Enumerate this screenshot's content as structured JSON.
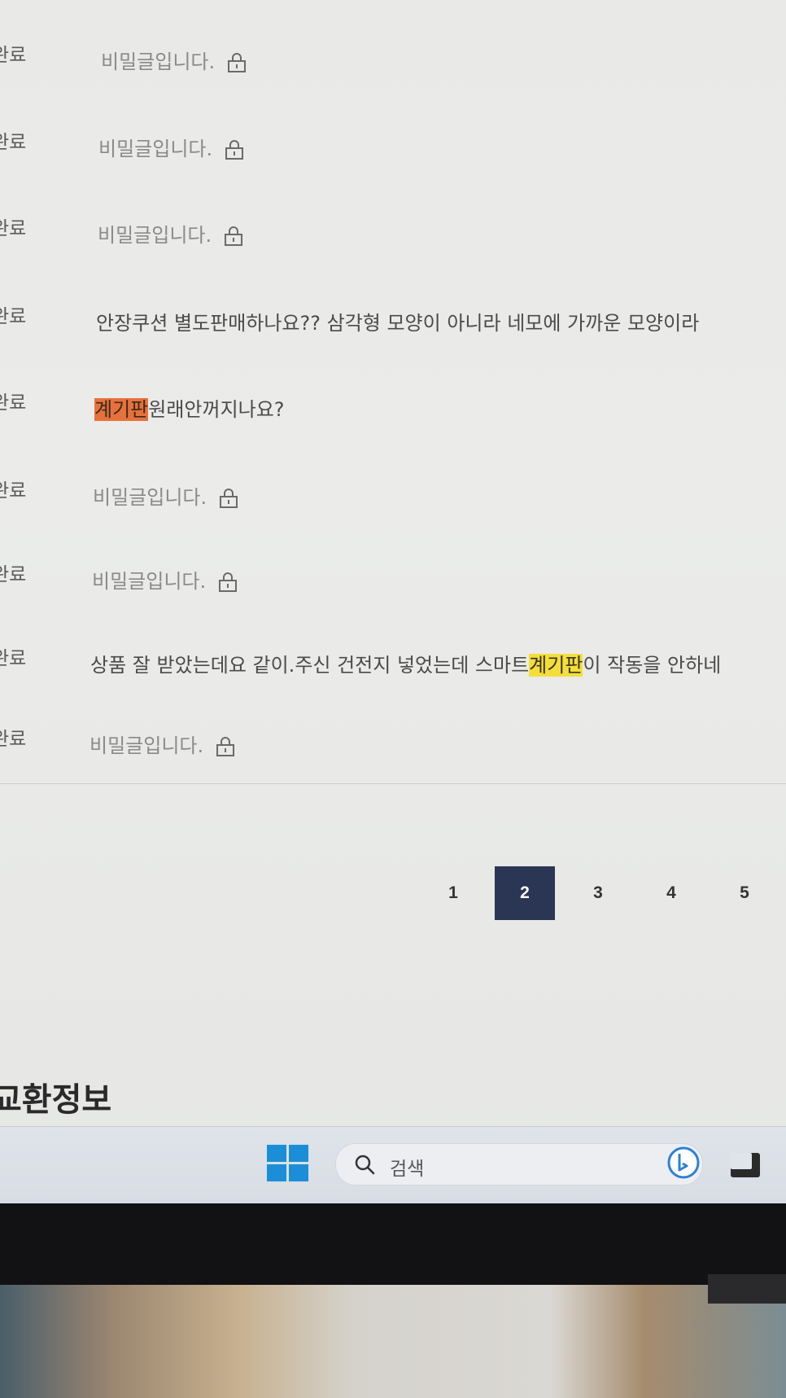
{
  "board": {
    "rows": [
      {
        "status": "완료",
        "title": "비밀글입니다.",
        "secret": true
      },
      {
        "status": "완료",
        "title": "비밀글입니다.",
        "secret": true
      },
      {
        "status": "완료",
        "title": "비밀글입니다.",
        "secret": true
      },
      {
        "status": "완료",
        "title": "안장쿠션 별도판매하나요?? 삼각형 모양이 아니라 네모에 가까운 모양이라",
        "secret": false
      },
      {
        "status": "완료",
        "title_highlight": "계기판",
        "title_rest": "원래안꺼지나요?",
        "secret": false
      },
      {
        "status": "완료",
        "title": "비밀글입니다.",
        "secret": true
      },
      {
        "status": "완료",
        "title": "비밀글입니다.",
        "secret": true
      },
      {
        "status": "완료",
        "title_before": "상품 잘 받았는데요 같이.주신 건전지 넣었는데 스마트",
        "title_highlight": "계기판",
        "title_after": "이 작동을 안하네",
        "secret": false
      },
      {
        "status": "완료",
        "title": "비밀글입니다.",
        "secret": true
      }
    ],
    "lock_icon": "lock-icon"
  },
  "pagination": {
    "pages": [
      "1",
      "2",
      "3",
      "4",
      "5"
    ],
    "active": "2"
  },
  "section": {
    "title": "교환정보"
  },
  "taskbar": {
    "search_placeholder": "검색",
    "start_icon": "windows-logo-icon",
    "search_icon": "search-icon",
    "bing_icon": "bing-icon",
    "taskview_icon": "task-view-icon"
  },
  "colors": {
    "active_page": "#2b3654",
    "highlight_orange": "#e8713a",
    "highlight_yellow": "#f4de3a",
    "windows_blue": "#1a8fd8"
  }
}
